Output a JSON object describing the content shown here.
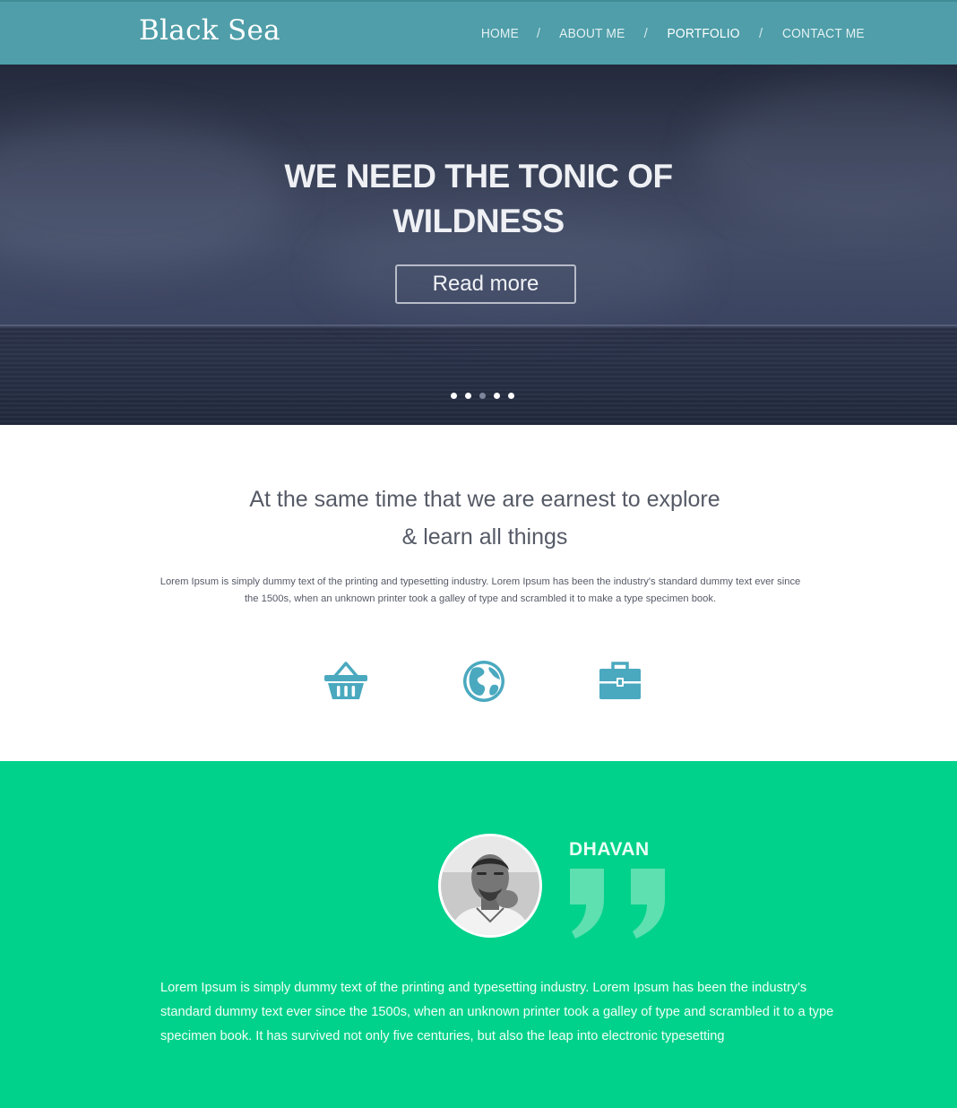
{
  "header": {
    "logo": "Black Sea",
    "nav": [
      {
        "label": "HOME",
        "active": false
      },
      {
        "label": "ABOUT ME",
        "active": false
      },
      {
        "label": "PORTFOLIO",
        "active": true
      },
      {
        "label": "CONTACT ME",
        "active": false
      }
    ],
    "separator": "/",
    "colors": {
      "bar": "#4f9ea9"
    }
  },
  "hero": {
    "title_line1": "WE NEED THE TONIC OF",
    "title_line2": "WILDNESS",
    "button_label": "Read more",
    "slider": {
      "count": 5,
      "active_index": 2
    }
  },
  "intro": {
    "heading_line1": "At the same time that we are earnest to explore",
    "heading_line2": "& learn all things",
    "text": "Lorem Ipsum is simply dummy text of the printing and typesetting industry. Lorem Ipsum has been the industry's standard dummy text ever since the 1500s, when an unknown printer took a galley of type and scrambled it to make a type specimen book.",
    "icons": [
      "basket-icon",
      "globe-icon",
      "briefcase-icon"
    ],
    "icon_color": "#4aa9bf"
  },
  "testimonial": {
    "name": "DHAVAN",
    "quote_icon": "quote-icon",
    "avatar_icon": "avatar",
    "text": "Lorem Ipsum is simply dummy text of the printing and typesetting industry. Lorem Ipsum has been the industry's standard dummy text ever since the 1500s, when an unknown printer took a galley of type and scrambled it to a type specimen book. It has survived not only five centuries, but also the leap into electronic typesetting",
    "background": "#00d28b"
  }
}
